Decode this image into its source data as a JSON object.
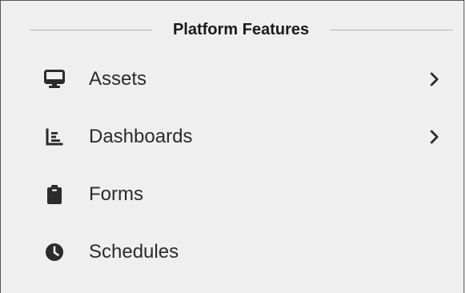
{
  "section": {
    "title": "Platform Features"
  },
  "items": [
    {
      "label": "Assets",
      "icon": "desktop-icon",
      "has_submenu": true
    },
    {
      "label": "Dashboards",
      "icon": "chart-area-icon",
      "has_submenu": true
    },
    {
      "label": "Forms",
      "icon": "clipboard-icon",
      "has_submenu": false
    },
    {
      "label": "Schedules",
      "icon": "clock-icon",
      "has_submenu": false
    }
  ],
  "colors": {
    "background": "#efefef",
    "text": "#2b2b2b",
    "icon": "#2b2b2b",
    "divider": "#b4b4b4"
  }
}
